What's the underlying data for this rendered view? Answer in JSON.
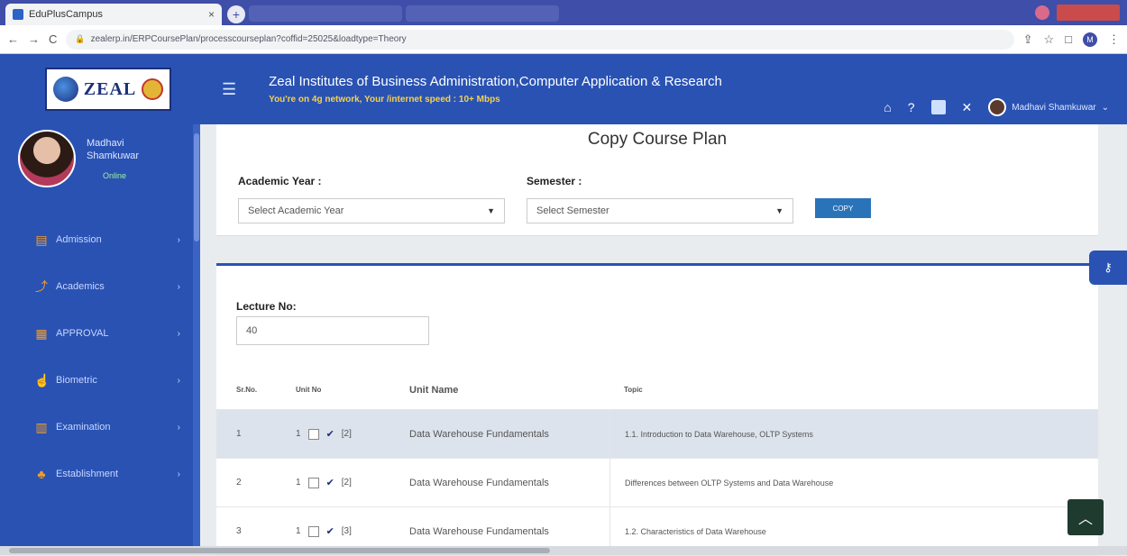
{
  "browser": {
    "tab_title": "EduPlusCampus",
    "tab_close": "×",
    "new_tab": "+",
    "url": "zealerp.in/ERPCoursePlan/processcourseplan?coffid=25025&loadtype=Theory",
    "nav_back": "←",
    "nav_forward": "→",
    "nav_reload": "C"
  },
  "header": {
    "logo_text": "ZEAL",
    "institute_name": "Zeal Institutes of Business Administration,Computer Application & Research",
    "network_status": "You're on 4g network, Your /internet speed : 10+ Mbps",
    "user_name": "Madhavi Shamkuwar"
  },
  "sidebar": {
    "profile_name_line1": "Madhavi",
    "profile_name_line2": "Shamkuwar",
    "profile_status": "Online",
    "items": [
      {
        "label": "Admission",
        "icon": "id-card-icon",
        "glyph": "▤"
      },
      {
        "label": "Academics",
        "icon": "chart-icon",
        "glyph": "⤴"
      },
      {
        "label": "APPROVAL",
        "icon": "clipboard-icon",
        "glyph": "▦"
      },
      {
        "label": "Biometric",
        "icon": "fingerprint-icon",
        "glyph": "☝"
      },
      {
        "label": "Examination",
        "icon": "building-icon",
        "glyph": "▥"
      },
      {
        "label": "Establishment",
        "icon": "group-icon",
        "glyph": "♣"
      }
    ]
  },
  "course_plan": {
    "title": "Copy Course Plan",
    "academic_year_label": "Academic Year :",
    "academic_year_value": "Select Academic Year",
    "semester_label": "Semester :",
    "semester_value": "Select Semester",
    "copy_button": "COPY"
  },
  "lecture": {
    "label": "Lecture No:",
    "value": "40"
  },
  "table": {
    "headers": [
      "Sr.No.",
      "Unit No",
      "Unit Name",
      "Topic"
    ],
    "rows": [
      {
        "sr": "1",
        "unit": "1",
        "count": "[2]",
        "unit_name": "Data Warehouse Fundamentals",
        "topic": "1.1. Introduction to Data Warehouse, OLTP Systems"
      },
      {
        "sr": "2",
        "unit": "1",
        "count": "[2]",
        "unit_name": "Data Warehouse Fundamentals",
        "topic": "Differences between OLTP Systems and Data Warehouse"
      },
      {
        "sr": "3",
        "unit": "1",
        "count": "[3]",
        "unit_name": "Data Warehouse Fundamentals",
        "topic": "1.2. Characteristics of Data Warehouse"
      }
    ]
  },
  "colors": {
    "brand_blue": "#2952b3",
    "accent_yellow": "#f5d24b",
    "button_blue": "#2a73b8"
  }
}
